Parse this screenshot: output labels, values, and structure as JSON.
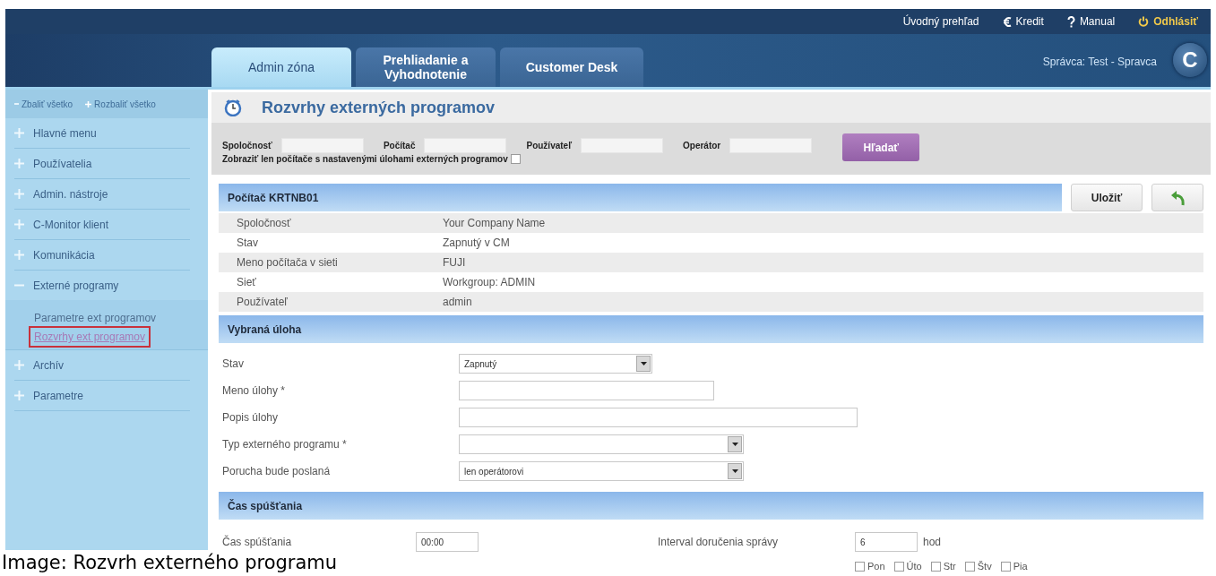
{
  "top_links": [
    {
      "kind": "plain",
      "label": "Úvodný prehľad"
    },
    {
      "kind": "euro",
      "label": "Kredit"
    },
    {
      "kind": "help",
      "label": "Manual"
    },
    {
      "kind": "logout",
      "label": "Odhlásiť"
    }
  ],
  "tabs": [
    {
      "label": "Admin zóna",
      "selected": true
    },
    {
      "label": "Prehliadanie a Vyhodnotenie",
      "selected": false
    },
    {
      "label": "Customer Desk",
      "selected": false
    }
  ],
  "user": "Správca: Test - Spravca",
  "logo": "C",
  "sidebar": {
    "collapse_all": "Zbaliť všetko",
    "expand_all": "Rozbaliť všetko",
    "items": [
      {
        "label": "Hlavné menu",
        "expanded": false
      },
      {
        "label": "Používatelia",
        "expanded": false
      },
      {
        "label": "Admin. nástroje",
        "expanded": false
      },
      {
        "label": "C-Monitor klient",
        "expanded": false
      },
      {
        "label": "Komunikácia",
        "expanded": false
      },
      {
        "label": "Externé programy",
        "expanded": true,
        "children": [
          {
            "label": "Parametre ext programov",
            "selected": false
          },
          {
            "label": "Rozvrhy ext programov",
            "selected": true
          }
        ]
      },
      {
        "label": "Archív",
        "expanded": false
      },
      {
        "label": "Parametre",
        "expanded": false
      }
    ]
  },
  "page_title": "Rozvrhy externých programov",
  "filter": {
    "fields": [
      {
        "label": "Spoločnosť"
      },
      {
        "label": "Počítač"
      },
      {
        "label": "Používateľ"
      },
      {
        "label": "Operátor"
      }
    ],
    "checkbox": {
      "label": "Zobraziť len počítače s nastavenými úlohami externých programov",
      "checked": false
    },
    "search_button": "Hľadať"
  },
  "computer": {
    "title": "Počítač KRTNB01",
    "save_button": "Uložiť",
    "rows": [
      {
        "label": "Spoločnosť",
        "value": "Your Company Name"
      },
      {
        "label": "Stav",
        "value": "Zapnutý v CM"
      },
      {
        "label": "Meno počítača v sieti",
        "value": "FUJI"
      },
      {
        "label": "Sieť",
        "value": "Workgroup: ADMIN"
      },
      {
        "label": "Používateľ",
        "value": "admin"
      }
    ]
  },
  "task": {
    "title": "Vybraná úloha",
    "fields": [
      {
        "kind": "select",
        "label": "Stav",
        "value": "Zapnutý"
      },
      {
        "kind": "text",
        "label": "Meno úlohy *"
      },
      {
        "kind": "text",
        "label": "Popis úlohy"
      },
      {
        "kind": "select",
        "label": "Typ externého programu *"
      },
      {
        "kind": "select",
        "label": "Porucha bude poslaná",
        "value": "len operátorovi"
      }
    ]
  },
  "schedule": {
    "title": "Čas spúšťania",
    "start": {
      "label": "Čas spúšťania",
      "value": "00:00"
    },
    "interval": {
      "label": "Interval doručenia správy",
      "value": "6",
      "unit": "hod"
    },
    "days": [
      {
        "label": "Pon",
        "checked": false
      },
      {
        "label": "Úto",
        "checked": false
      },
      {
        "label": "Str",
        "checked": false
      },
      {
        "label": "Štv",
        "checked": false
      },
      {
        "label": "Pia",
        "checked": false
      }
    ]
  },
  "caption": "Image: Rozvrh externého programu"
}
